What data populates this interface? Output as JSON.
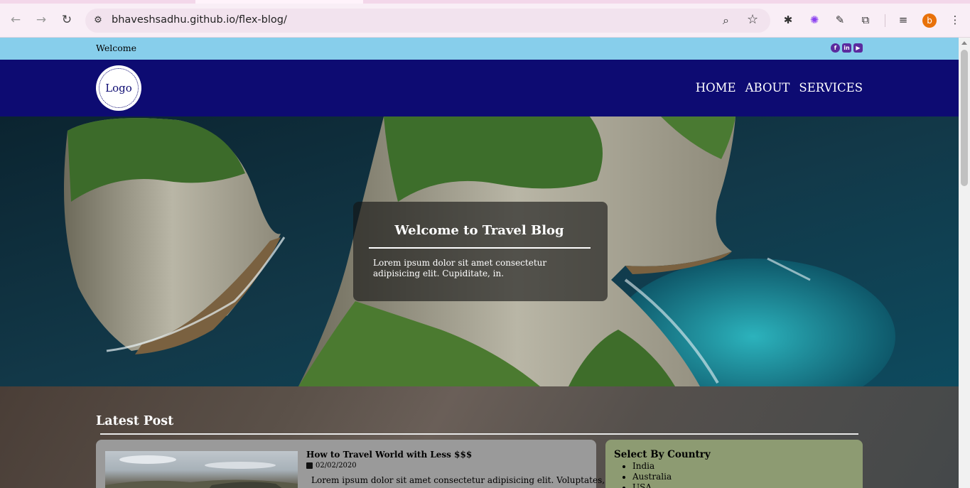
{
  "browser": {
    "url": "bhaveshsadhu.github.io/flex-blog/",
    "profile_initial": "b",
    "accent": "#e8710a"
  },
  "topbar": {
    "welcome": "Welcome",
    "social_icons": [
      "facebook-icon",
      "linkedin-icon",
      "youtube-icon"
    ],
    "social_labels": [
      "f",
      "in",
      "▶"
    ]
  },
  "header": {
    "logo": "Logo",
    "nav": [
      "HOME",
      "ABOUT",
      "SERVICES"
    ],
    "color": "#0d0b72"
  },
  "hero": {
    "title": "Welcome to Travel Blog",
    "text": "Lorem ipsum dolor sit amet consectetur adipisicing elit. Cupiditate, in."
  },
  "latest": {
    "heading": "Latest Post",
    "post": {
      "title": "How to Travel World with Less $$$",
      "date": "02/02/2020",
      "excerpt": "Lorem ipsum dolor sit amet consectetur adipisicing elit. Voluptates,"
    }
  },
  "sidebar": {
    "heading": "Select By Country",
    "countries": [
      "India",
      "Australia",
      "USA"
    ]
  }
}
